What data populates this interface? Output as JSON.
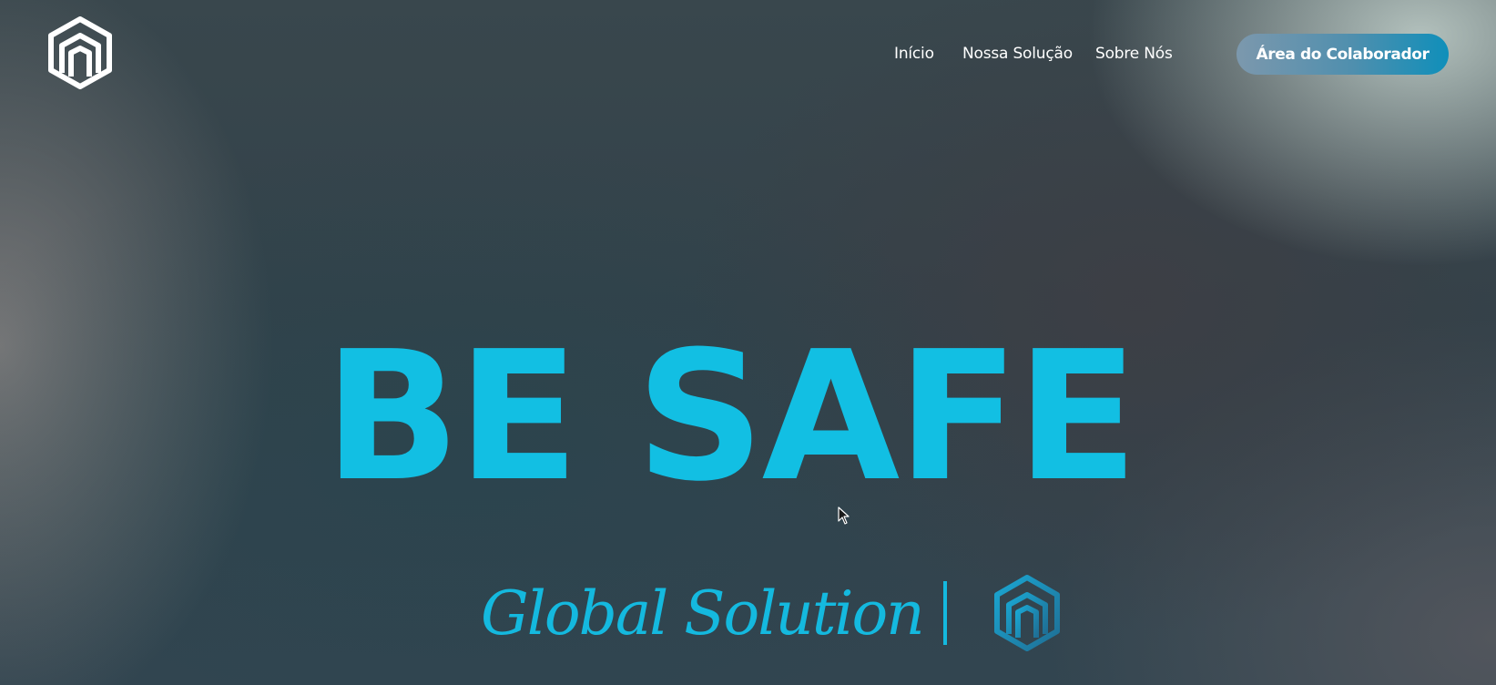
{
  "header": {
    "logo_icon": "brand-hexagon-m-icon",
    "nav": [
      {
        "label": "Início"
      },
      {
        "label": "Nossa Solução"
      },
      {
        "label": "Sobre Nós"
      }
    ],
    "cta_label": "Área do Colaborador"
  },
  "hero": {
    "title": "BE SAFE",
    "subtitle": "Global Solution",
    "divider": "|",
    "subtitle_icon": "brand-hexagon-m-icon"
  },
  "colors": {
    "accent": "#12bfe3",
    "cta_start": "#7c98ad",
    "cta_end": "#0f8fba",
    "nav_text": "#ffffff"
  },
  "cursor_icon": "mouse-pointer-icon"
}
